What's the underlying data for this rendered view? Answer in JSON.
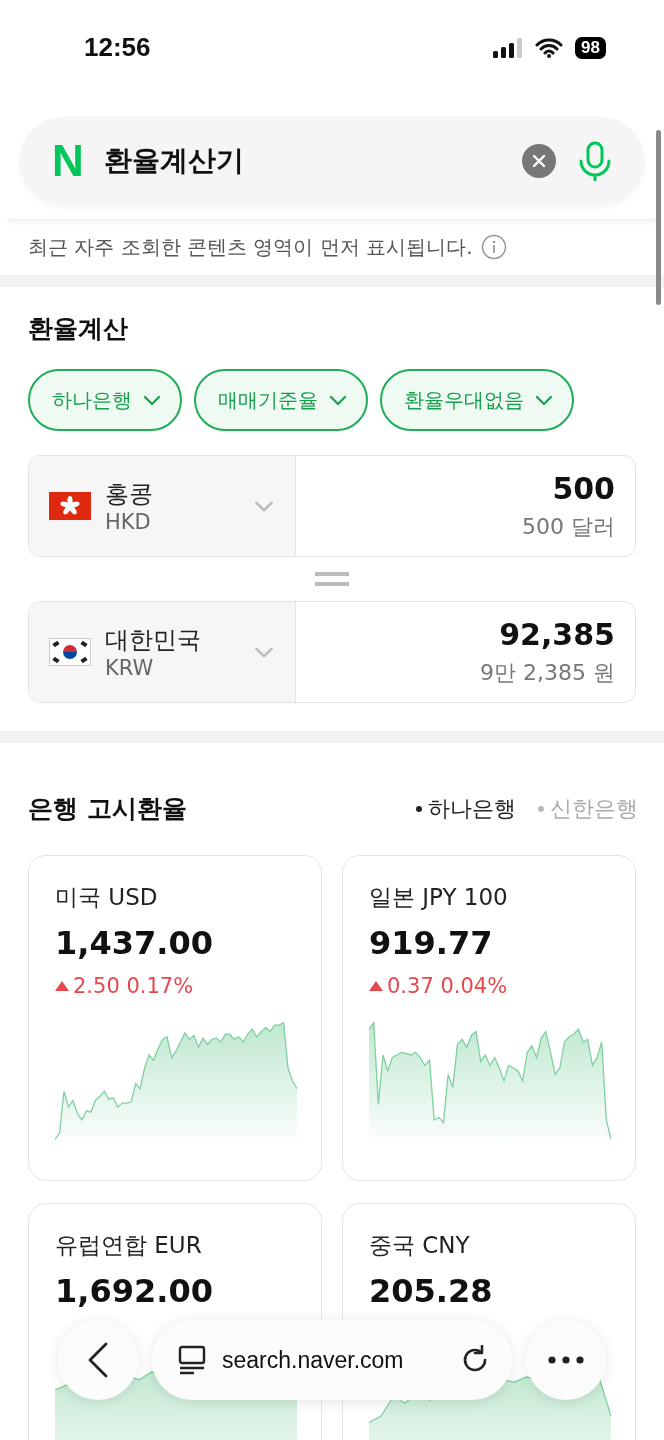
{
  "status_bar": {
    "time": "12:56",
    "battery": "98"
  },
  "search": {
    "logo": "N",
    "query": "환율계산기"
  },
  "notice": "최근 자주 조회한 콘텐츠 영역이 먼저 표시됩니다.",
  "calculator": {
    "title": "환율계산",
    "chips": [
      {
        "label": "하나은행"
      },
      {
        "label": "매매기준율"
      },
      {
        "label": "환율우대없음"
      }
    ],
    "rows": [
      {
        "country": "홍콩",
        "code": "HKD",
        "amount": "500",
        "amount_words": "500 달러"
      },
      {
        "country": "대한민국",
        "code": "KRW",
        "amount": "92,385",
        "amount_words": "9만 2,385 원"
      }
    ]
  },
  "rates": {
    "title": "은행 고시환율",
    "banks": [
      {
        "label": "하나은행",
        "selected": true
      },
      {
        "label": "신한은행",
        "selected": false
      }
    ],
    "cards": [
      {
        "name": "미국 USD",
        "value": "1,437.00",
        "change": "2.50 0.17%"
      },
      {
        "name": "일본 JPY 100",
        "value": "919.77",
        "change": "0.37 0.04%"
      },
      {
        "name": "유럽연합 EUR",
        "value": "1,692.00"
      },
      {
        "name": "중국 CNY",
        "value": "205.28"
      }
    ]
  },
  "browser_bar": {
    "url": "search.naver.com"
  }
}
